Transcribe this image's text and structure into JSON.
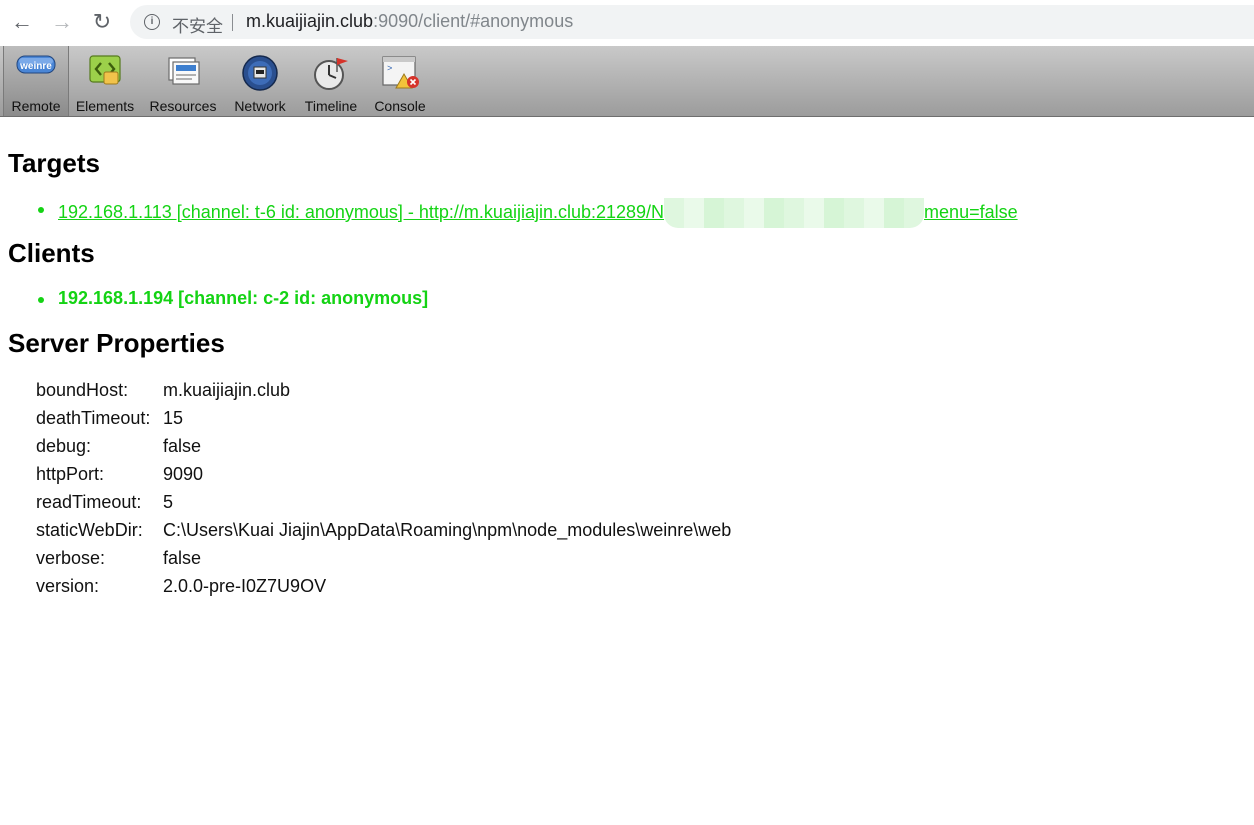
{
  "browser": {
    "back_glyph": "←",
    "forward_glyph": "→",
    "reload_glyph": "↻",
    "info_glyph": "i",
    "insecure_label": "不安全",
    "url_host": "m.kuaijiajin.club",
    "url_rest": ":9090/client/#anonymous"
  },
  "toolbar": {
    "items": [
      {
        "label": "Remote",
        "icon": "weinre-logo-icon",
        "logo_text": "weinre"
      },
      {
        "label": "Elements",
        "icon": "elements-icon"
      },
      {
        "label": "Resources",
        "icon": "resources-icon"
      },
      {
        "label": "Network",
        "icon": "network-icon"
      },
      {
        "label": "Timeline",
        "icon": "timeline-icon"
      },
      {
        "label": "Console",
        "icon": "console-icon"
      }
    ]
  },
  "sections": {
    "targets_title": "Targets",
    "clients_title": "Clients",
    "server_title": "Server Properties"
  },
  "targets": [
    {
      "text_before": "192.168.1.113 [channel: t-6 id: anonymous] - http://m.kuaijiajin.club:21289/N",
      "text_after": "menu=false"
    }
  ],
  "clients": [
    {
      "text": "192.168.1.194 [channel: c-2 id: anonymous]"
    }
  ],
  "server_properties": [
    {
      "key": "boundHost:",
      "value": "m.kuaijiajin.club"
    },
    {
      "key": "deathTimeout:",
      "value": "15"
    },
    {
      "key": "debug:",
      "value": "false"
    },
    {
      "key": "httpPort:",
      "value": "9090"
    },
    {
      "key": "readTimeout:",
      "value": "5"
    },
    {
      "key": "staticWebDir:",
      "value": "C:\\Users\\Kuai Jiajin\\AppData\\Roaming\\npm\\node_modules\\weinre\\web"
    },
    {
      "key": "verbose:",
      "value": "false"
    },
    {
      "key": "version:",
      "value": "2.0.0-pre-I0Z7U9OV"
    }
  ],
  "colors": {
    "accent_green": "#14d314",
    "toolbar_top": "#c9c9c9",
    "toolbar_bottom": "#9c9c9c"
  }
}
